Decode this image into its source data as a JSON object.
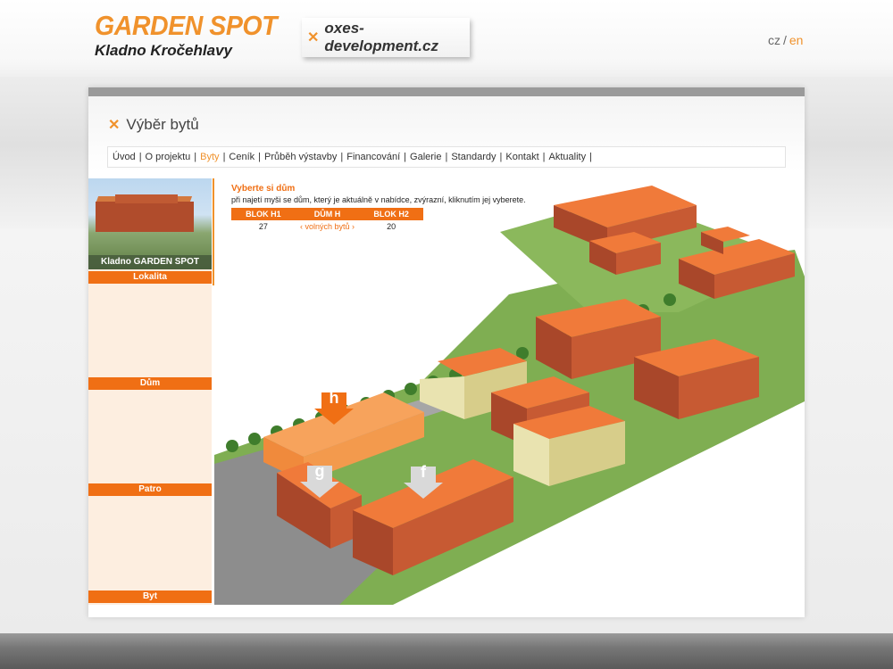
{
  "header": {
    "logo_title": "GARDEN SPOT",
    "logo_subtitle": "Kladno Kročehlavy",
    "developer_link": "oxes-development.cz",
    "lang_cz": "cz",
    "lang_sep": "/",
    "lang_en": "en"
  },
  "page": {
    "title": "Výběr bytů"
  },
  "nav": {
    "items": [
      "Úvod",
      "O projektu",
      "Byty",
      "Ceník",
      "Průběh výstavby",
      "Financování",
      "Galerie",
      "Standardy",
      "Kontakt",
      "Aktuality"
    ],
    "active": "Byty",
    "separator": "|"
  },
  "sidebar": {
    "photo_caption": "Kladno GARDEN SPOT",
    "steps": [
      "Lokalita",
      "Dům",
      "Patro",
      "Byt"
    ]
  },
  "info": {
    "heading": "Vyberte si dům",
    "text": "při najetí myši se dům, který je aktuálně v nabídce, zvýrazní, kliknutím jej vyberete.",
    "table_headers": [
      "BLOK H1",
      "DŮM H",
      "BLOK H2"
    ],
    "row": {
      "left": "27",
      "middle_prefix": "‹",
      "middle": "volných bytů",
      "middle_suffix": "›",
      "right": "20"
    }
  },
  "map": {
    "markers": [
      "h",
      "g",
      "f"
    ]
  },
  "colors": {
    "accent": "#f0922c",
    "button": "#f06f14",
    "roof": "#f07a3a",
    "brick": "#a9472a"
  }
}
